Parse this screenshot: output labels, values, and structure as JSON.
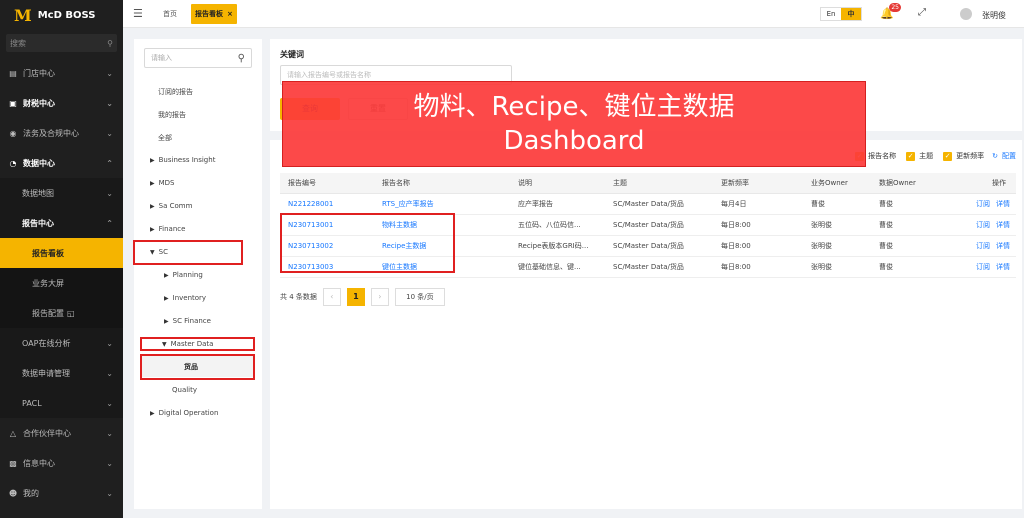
{
  "sidebar": {
    "logo_mark": "M",
    "logo_text": "McD BOSS",
    "search_placeholder": "搜索",
    "items": [
      {
        "label": "门店中心",
        "icon": "store-icon"
      },
      {
        "label": "财税中心",
        "icon": "finance-icon"
      },
      {
        "label": "法务及合规中心",
        "icon": "legal-icon"
      },
      {
        "label": "数据中心",
        "icon": "data-icon"
      },
      {
        "label": "数据地图"
      },
      {
        "label": "报告中心"
      },
      {
        "label": "报告看板"
      },
      {
        "label": "业务大屏"
      },
      {
        "label": "报告配置"
      },
      {
        "label": "OAP在线分析"
      },
      {
        "label": "数据申请管理"
      },
      {
        "label": "PACL"
      },
      {
        "label": "合作伙伴中心",
        "icon": "partner-icon"
      },
      {
        "label": "信息中心",
        "icon": "message-icon"
      },
      {
        "label": "我的",
        "icon": "user-icon"
      }
    ]
  },
  "topbar": {
    "tabs": [
      {
        "label": "首页"
      },
      {
        "label": "报告看板"
      }
    ],
    "lang_en": "En",
    "lang_zh": "中",
    "notification_count": "25",
    "user_name": "张明俊"
  },
  "tree": {
    "search_placeholder": "请输入",
    "items": [
      "订阅的报告",
      "我的报告",
      "全部",
      "Business Insight",
      "MDS",
      "Sa Comm",
      "Finance",
      "SC",
      "Planning",
      "Inventory",
      "SC Finance",
      "Master Data",
      "货品",
      "Quality",
      "Digital Operation"
    ]
  },
  "main": {
    "keyword_label": "关键词",
    "keyword_placeholder": "请输入报告编号或报告名称",
    "query_button": "查询",
    "reset_button": "重置",
    "option_report_name": "报告名称",
    "option_theme": "主题",
    "option_frequency": "更新频率",
    "option_config": "配置",
    "columns": [
      "报告编号",
      "报告名称",
      "说明",
      "主题",
      "更新频率",
      "业务Owner",
      "数据Owner",
      "操作"
    ],
    "rows": [
      [
        "N221228001",
        "RTS_应产率报告",
        "应产率报告",
        "SC/Master Data/货品",
        "每月4日",
        "曹俊",
        "曹俊"
      ],
      [
        "N230713001",
        "物料主数据",
        "五位码、八位码信...",
        "SC/Master Data/货品",
        "每日8:00",
        "张明俊",
        "曹俊"
      ],
      [
        "N230713002",
        "Recipe主数据",
        "Recipe表版本GRI码...",
        "SC/Master Data/货品",
        "每日8:00",
        "张明俊",
        "曹俊"
      ],
      [
        "N230713003",
        "键位主数据",
        "键位基础信息、键...",
        "SC/Master Data/货品",
        "每日8:00",
        "张明俊",
        "曹俊"
      ]
    ],
    "op_subscribe": "订阅",
    "op_detail": "详情",
    "total_text": "共 4 条数据",
    "page_current": "1",
    "page_size": "10 条/页"
  },
  "overlay": {
    "line1": "物料、Recipe、键位主数据",
    "line2": "Dashboard"
  }
}
